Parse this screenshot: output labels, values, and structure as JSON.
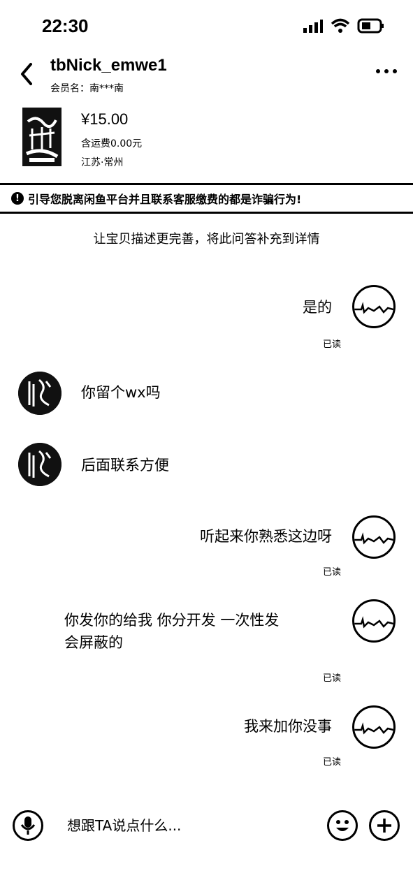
{
  "status_bar": {
    "time": "22:30"
  },
  "header": {
    "nickname": "tbNick_emwe1",
    "member_name": "会员名：南***南"
  },
  "product": {
    "price": "¥15.00",
    "shipping": "含运费0.00元",
    "location": "江苏·常州"
  },
  "warning": {
    "text": "引导您脱离闲鱼平台并且联系客服缴费的都是诈骗行为!"
  },
  "system_message": "让宝贝描述更完善，将此问答补充到详情",
  "messages": [
    {
      "side": "mine",
      "text": "是的",
      "status": "已读"
    },
    {
      "side": "other",
      "text": "你留个wx吗"
    },
    {
      "side": "other",
      "text": "后面联系方便"
    },
    {
      "side": "mine",
      "text": "听起来你熟悉这边呀",
      "status": "已读"
    },
    {
      "side": "mine",
      "text_line1": "你发你的给我 你分开发  一次性发",
      "text_line2": "会屏蔽的",
      "status": "已读"
    },
    {
      "side": "mine",
      "text": "我来加你没事",
      "status": "已读"
    }
  ],
  "input": {
    "placeholder": "想跟TA说点什么..."
  },
  "icons": {
    "back": "chevron-left-icon",
    "more": "more-dots-icon",
    "mic": "microphone-icon",
    "emoji": "emoji-icon",
    "plus": "plus-icon",
    "warning": "info-circle-icon",
    "signal": "signal-icon",
    "wifi": "wifi-icon",
    "battery": "battery-icon"
  }
}
